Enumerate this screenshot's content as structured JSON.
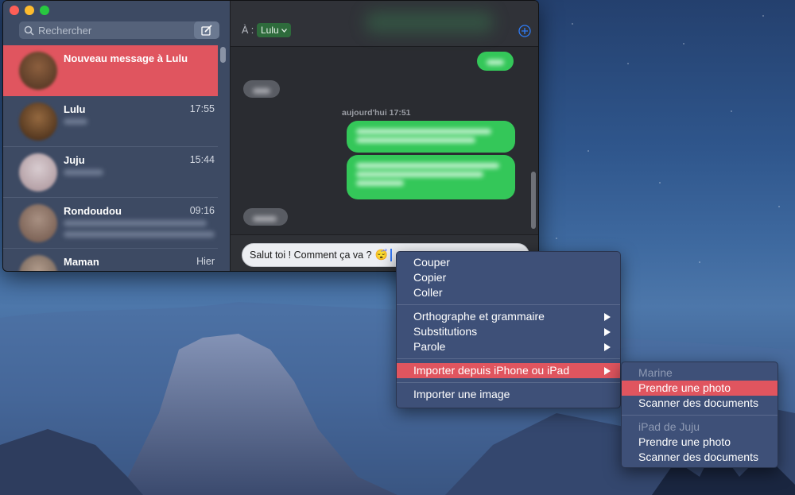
{
  "window": {
    "search_placeholder": "Rechercher",
    "conversations": [
      {
        "name": "Nouveau message à Lulu",
        "time": ""
      },
      {
        "name": "Lulu",
        "time": "17:55"
      },
      {
        "name": "Juju",
        "time": "15:44"
      },
      {
        "name": "Rondoudou",
        "time": "09:16"
      },
      {
        "name": "Maman",
        "time": "Hier"
      }
    ],
    "to_label": "À :",
    "recipient": "Lulu",
    "timestamp": "aujourd'hui 17:51",
    "compose_text": "Salut toi ! Comment ça va ?",
    "compose_emoji": "😴"
  },
  "context_menu": {
    "items": [
      "Couper",
      "Copier",
      "Coller",
      "Orthographe et grammaire",
      "Substitutions",
      "Parole",
      "Importer depuis iPhone ou iPad",
      "Importer une image"
    ]
  },
  "submenu": {
    "device1": "Marine",
    "device1_items": [
      "Prendre une photo",
      "Scanner des documents"
    ],
    "device2": "iPad de Juju",
    "device2_items": [
      "Prendre une photo",
      "Scanner des documents"
    ]
  },
  "colors": {
    "accent": "#e0555f",
    "imessage_green": "#34c759",
    "sidebar": "#3d4a63"
  },
  "icons": [
    "search-icon",
    "compose-icon",
    "chevron-down-icon",
    "add-circle-icon",
    "submenu-arrow-icon"
  ]
}
